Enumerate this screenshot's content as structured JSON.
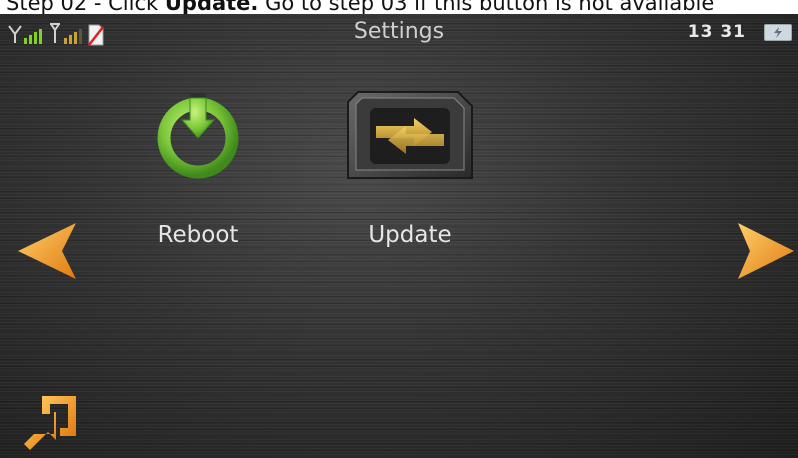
{
  "caption": {
    "prefix": "Step 02 - Click ",
    "bold": "Update.",
    "suffix": " Go to step 03 if this button is not available"
  },
  "statusbar": {
    "title": "Settings",
    "time": "13 31"
  },
  "tiles": [
    {
      "label": "Reboot",
      "icon": "power-icon"
    },
    {
      "label": "Update",
      "icon": "sim-update-icon"
    }
  ],
  "colors": {
    "accent_orange": "#f59a1c",
    "power_green": "#8bd64a",
    "signal_green": "#7ed321"
  }
}
